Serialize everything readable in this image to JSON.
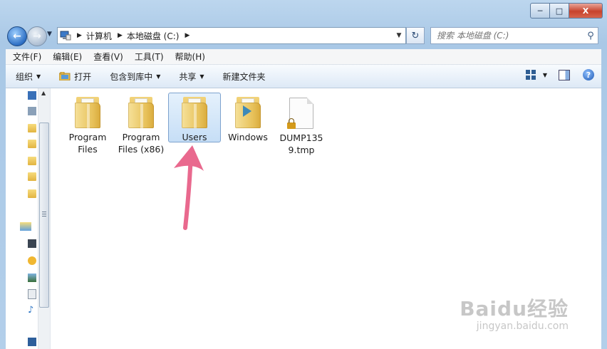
{
  "window": {
    "caption": {
      "minimize": "─",
      "maximize": "□",
      "close": "X"
    }
  },
  "nav": {
    "back_icon": "back-arrow-icon",
    "forward_icon": "forward-arrow-icon",
    "breadcrumbs": [
      "计算机",
      "本地磁盘 (C:)"
    ],
    "search_placeholder": "搜索 本地磁盘 (C:)"
  },
  "menubar": [
    "文件(F)",
    "编辑(E)",
    "查看(V)",
    "工具(T)",
    "帮助(H)"
  ],
  "commands": {
    "organize": "组织",
    "open": "打开",
    "include_library": "包含到库中",
    "share": "共享",
    "new_folder": "新建文件夹"
  },
  "files": [
    {
      "line1": "Program",
      "line2": "Files",
      "type": "folder"
    },
    {
      "line1": "Program",
      "line2": "Files (x86)",
      "type": "folder"
    },
    {
      "line1": "Users",
      "line2": "",
      "type": "folder",
      "selected": true
    },
    {
      "line1": "Windows",
      "line2": "",
      "type": "folder"
    },
    {
      "line1": "DUMP135",
      "line2": "9.tmp",
      "type": "locked-file"
    }
  ],
  "watermark": {
    "main": "Baidu经验",
    "sub": "jingyan.baidu.com"
  },
  "annotation": {
    "arrow_color": "#e9698e"
  }
}
